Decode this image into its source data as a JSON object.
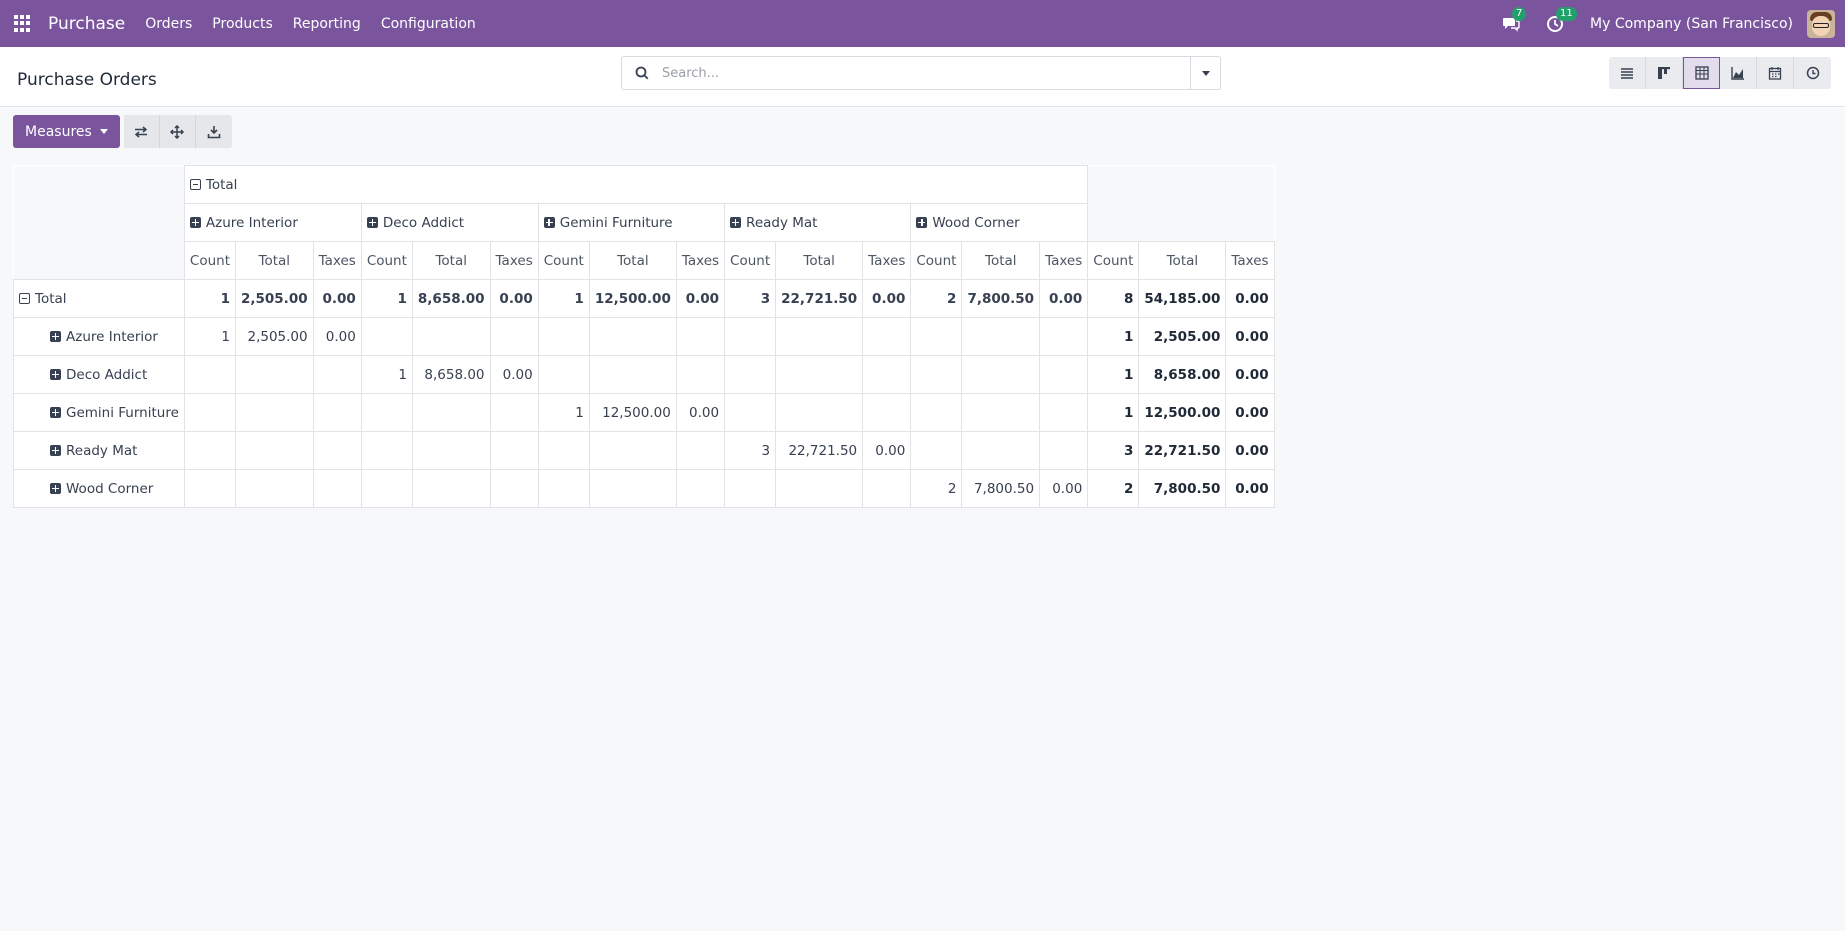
{
  "navbar": {
    "app_name": "Purchase",
    "menu": [
      "Orders",
      "Products",
      "Reporting",
      "Configuration"
    ],
    "messages_count": "7",
    "activities_count": "11",
    "company": "My Company (San Francisco)"
  },
  "control_panel": {
    "title": "Purchase Orders",
    "search_placeholder": "Search...",
    "views": [
      "list-icon",
      "kanban-icon",
      "pivot-icon",
      "graph-icon",
      "calendar-icon",
      "activity-icon"
    ],
    "active_view": "pivot-icon"
  },
  "toolbar": {
    "measures_label": "Measures",
    "buttons": [
      "flip-axis-icon",
      "expand-all-icon",
      "download-icon"
    ]
  },
  "pivot": {
    "col_total_label": "Total",
    "col_groups": [
      "Azure Interior",
      "Deco Addict",
      "Gemini Furniture",
      "Ready Mat",
      "Wood Corner"
    ],
    "measures": [
      "Count",
      "Total",
      "Taxes"
    ],
    "rows": [
      {
        "label": "Total",
        "is_total": true,
        "cells": [
          [
            "1",
            "2,505.00",
            "0.00"
          ],
          [
            "1",
            "8,658.00",
            "0.00"
          ],
          [
            "1",
            "12,500.00",
            "0.00"
          ],
          [
            "3",
            "22,721.50",
            "0.00"
          ],
          [
            "2",
            "7,800.50",
            "0.00"
          ],
          [
            "8",
            "54,185.00",
            "0.00"
          ]
        ]
      },
      {
        "label": "Azure Interior",
        "is_total": false,
        "cells": [
          [
            "1",
            "2,505.00",
            "0.00"
          ],
          [
            "",
            "",
            ""
          ],
          [
            "",
            "",
            ""
          ],
          [
            "",
            "",
            ""
          ],
          [
            "",
            "",
            ""
          ],
          [
            "1",
            "2,505.00",
            "0.00"
          ]
        ]
      },
      {
        "label": "Deco Addict",
        "is_total": false,
        "cells": [
          [
            "",
            "",
            ""
          ],
          [
            "1",
            "8,658.00",
            "0.00"
          ],
          [
            "",
            "",
            ""
          ],
          [
            "",
            "",
            ""
          ],
          [
            "",
            "",
            ""
          ],
          [
            "1",
            "8,658.00",
            "0.00"
          ]
        ]
      },
      {
        "label": "Gemini Furniture",
        "is_total": false,
        "cells": [
          [
            "",
            "",
            ""
          ],
          [
            "",
            "",
            ""
          ],
          [
            "1",
            "12,500.00",
            "0.00"
          ],
          [
            "",
            "",
            ""
          ],
          [
            "",
            "",
            ""
          ],
          [
            "1",
            "12,500.00",
            "0.00"
          ]
        ]
      },
      {
        "label": "Ready Mat",
        "is_total": false,
        "cells": [
          [
            "",
            "",
            ""
          ],
          [
            "",
            "",
            ""
          ],
          [
            "",
            "",
            ""
          ],
          [
            "3",
            "22,721.50",
            "0.00"
          ],
          [
            "",
            "",
            ""
          ],
          [
            "3",
            "22,721.50",
            "0.00"
          ]
        ]
      },
      {
        "label": "Wood Corner",
        "is_total": false,
        "cells": [
          [
            "",
            "",
            ""
          ],
          [
            "",
            "",
            ""
          ],
          [
            "",
            "",
            ""
          ],
          [
            "",
            "",
            ""
          ],
          [
            "2",
            "7,800.50",
            "0.00"
          ],
          [
            "2",
            "7,800.50",
            "0.00"
          ]
        ]
      }
    ]
  }
}
